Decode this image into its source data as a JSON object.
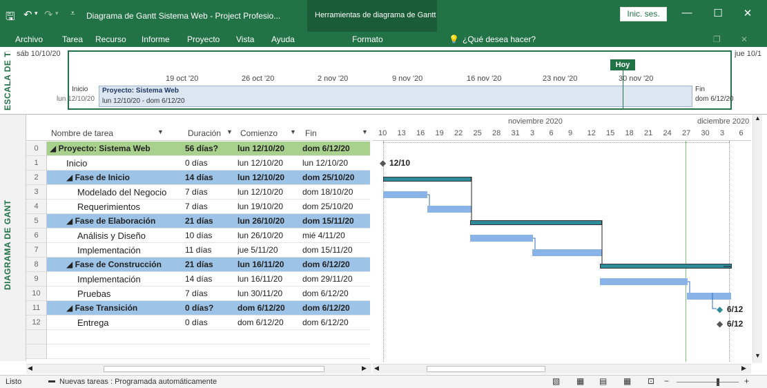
{
  "title_bar": {
    "title": "Diagrama de Gantt Sistema Web - Project Profesio...",
    "contextual_tab_group": "Herramientas de diagrama de Gantt",
    "signin_label": "Inic. ses."
  },
  "ribbon": {
    "tabs": [
      "Archivo",
      "Tarea",
      "Recurso",
      "Informe",
      "Proyecto",
      "Vista",
      "Ayuda"
    ],
    "contextual_tab": "Formato",
    "tell_me": "¿Qué desea hacer?"
  },
  "timeline": {
    "side_label": "ESCALA DE TIEMPO",
    "start_date_top": "sáb 10/10/20",
    "end_date_top": "jue 10/1",
    "today_label": "Hoy",
    "ticks": [
      "19 oct '20",
      "26 oct '20",
      "2 nov '20",
      "9 nov '20",
      "16 nov '20",
      "23 nov '20",
      "30 nov '20"
    ],
    "start_label": "Inicio",
    "start_date": "lun 12/10/20",
    "finish_label": "Fin",
    "finish_date": "dom 6/12/20",
    "project_name": "Proyecto: Sistema Web",
    "project_range": "lun 12/10/20 - dom 6/12/20"
  },
  "gantt_side_label": "DIAGRAMA DE GANTT",
  "table": {
    "columns": [
      "Nombre de tarea",
      "Duración",
      "Comienzo",
      "Fin"
    ],
    "rows": [
      {
        "id": "0",
        "name": "◢ Proyecto: Sistema Web",
        "duration": "56 días?",
        "start": "lun 12/10/20",
        "finish": "dom 6/12/20",
        "level": 0,
        "type": "project"
      },
      {
        "id": "1",
        "name": "Inicio",
        "duration": "0 días",
        "start": "lun 12/10/20",
        "finish": "lun 12/10/20",
        "level": 1,
        "type": "task"
      },
      {
        "id": "2",
        "name": "◢ Fase de Inicio",
        "duration": "14 días",
        "start": "lun 12/10/20",
        "finish": "dom 25/10/20",
        "level": 1,
        "type": "summary"
      },
      {
        "id": "3",
        "name": "Modelado del Negocio",
        "duration": "7 días",
        "start": "lun 12/10/20",
        "finish": "dom 18/10/20",
        "level": 2,
        "type": "task"
      },
      {
        "id": "4",
        "name": "Requerimientos",
        "duration": "7 días",
        "start": "lun 19/10/20",
        "finish": "dom 25/10/20",
        "level": 2,
        "type": "task"
      },
      {
        "id": "5",
        "name": "◢ Fase de Elaboración",
        "duration": "21 días",
        "start": "lun 26/10/20",
        "finish": "dom 15/11/20",
        "level": 1,
        "type": "summary"
      },
      {
        "id": "6",
        "name": "Análisis y Diseño",
        "duration": "10 días",
        "start": "lun 26/10/20",
        "finish": "mié 4/11/20",
        "level": 2,
        "type": "task"
      },
      {
        "id": "7",
        "name": "Implementación",
        "duration": "11 días",
        "start": "jue 5/11/20",
        "finish": "dom 15/11/20",
        "level": 2,
        "type": "task"
      },
      {
        "id": "8",
        "name": "◢ Fase de Construcción",
        "duration": "21 días",
        "start": "lun 16/11/20",
        "finish": "dom 6/12/20",
        "level": 1,
        "type": "summary"
      },
      {
        "id": "9",
        "name": "Implementación",
        "duration": "14 días",
        "start": "lun 16/11/20",
        "finish": "dom 29/11/20",
        "level": 2,
        "type": "task"
      },
      {
        "id": "10",
        "name": "Pruebas",
        "duration": "7 días",
        "start": "lun 30/11/20",
        "finish": "dom 6/12/20",
        "level": 2,
        "type": "task"
      },
      {
        "id": "11",
        "name": "◢ Fase Transición",
        "duration": "0 días?",
        "start": "dom 6/12/20",
        "finish": "dom 6/12/20",
        "level": 1,
        "type": "summary"
      },
      {
        "id": "12",
        "name": "Entrega",
        "duration": "0 días",
        "start": "dom 6/12/20",
        "finish": "dom 6/12/20",
        "level": 2,
        "type": "task"
      }
    ]
  },
  "chart_header": {
    "months": [
      "noviembre 2020",
      "diciembre 2020"
    ],
    "days": [
      "10",
      "13",
      "16",
      "19",
      "22",
      "25",
      "28",
      "31",
      "3",
      "6",
      "9",
      "12",
      "15",
      "18",
      "21",
      "24",
      "27",
      "30",
      "3",
      "6"
    ]
  },
  "milestones": {
    "inicio": "12/10",
    "transicion": "6/12",
    "entrega": "6/12"
  },
  "status": {
    "ready": "Listo",
    "new_tasks": "Nuevas tareas : Programada automáticamente"
  },
  "colors": {
    "accent": "#217346",
    "project_row": "#a9d18e",
    "summary_row": "#9dc3e6",
    "task_bar": "#8ab4e8",
    "summary_bar": "#2e8b9a"
  }
}
